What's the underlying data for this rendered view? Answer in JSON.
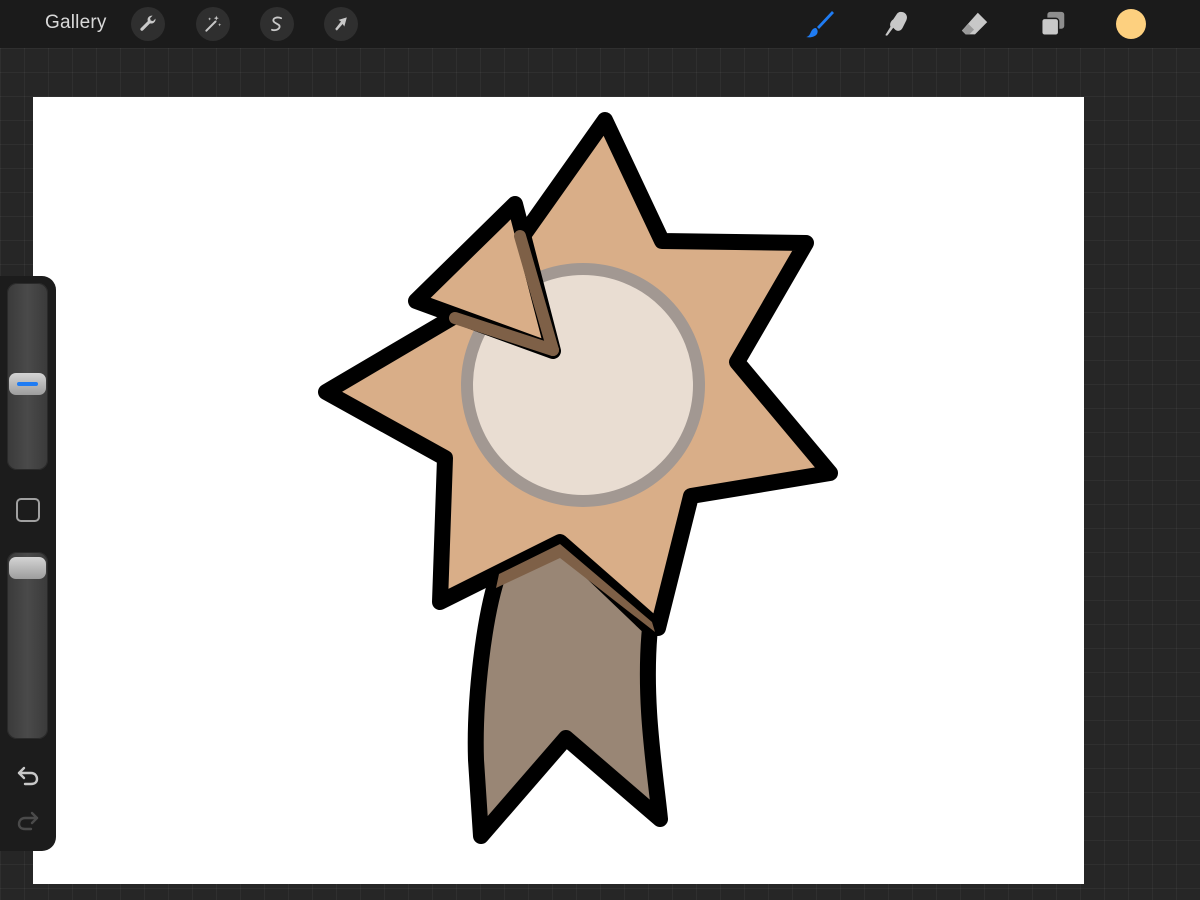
{
  "topbar": {
    "gallery_label": "Gallery",
    "left_tools": [
      {
        "name": "actions",
        "icon": "wrench-icon"
      },
      {
        "name": "adjustments",
        "icon": "magic-wand-icon"
      },
      {
        "name": "selection",
        "icon": "selection-s-icon"
      },
      {
        "name": "transform",
        "icon": "arrow-cursor-icon"
      }
    ],
    "right_tools": [
      {
        "name": "brush",
        "icon": "brush-icon",
        "active": true
      },
      {
        "name": "smudge",
        "icon": "smudge-finger-icon",
        "active": false
      },
      {
        "name": "eraser",
        "icon": "eraser-icon",
        "active": false
      },
      {
        "name": "layers",
        "icon": "layers-icon",
        "active": false
      }
    ],
    "current_color": "#FDD07F"
  },
  "colors": {
    "accent": "#1F7CF3",
    "icon_gray": "#C8C8C8",
    "canvas_background": "#FFFFFF",
    "workspace_background": "#262626",
    "star_fill": "#D9AE88",
    "circle_fill": "#E9DDD2",
    "circle_ring": "#A29892",
    "ribbon_fill": "#998675",
    "shadow": "#7E6047",
    "outline": "#000000"
  },
  "sidebar": {
    "brush_size_level": 0.45,
    "opacity_level": 0.0,
    "modify_icon": "square-modify-icon",
    "undo_icon": "undo-icon",
    "redo_icon": "redo-icon",
    "redo_enabled": false
  },
  "artwork": {
    "subject": "badge-award-illustration"
  }
}
